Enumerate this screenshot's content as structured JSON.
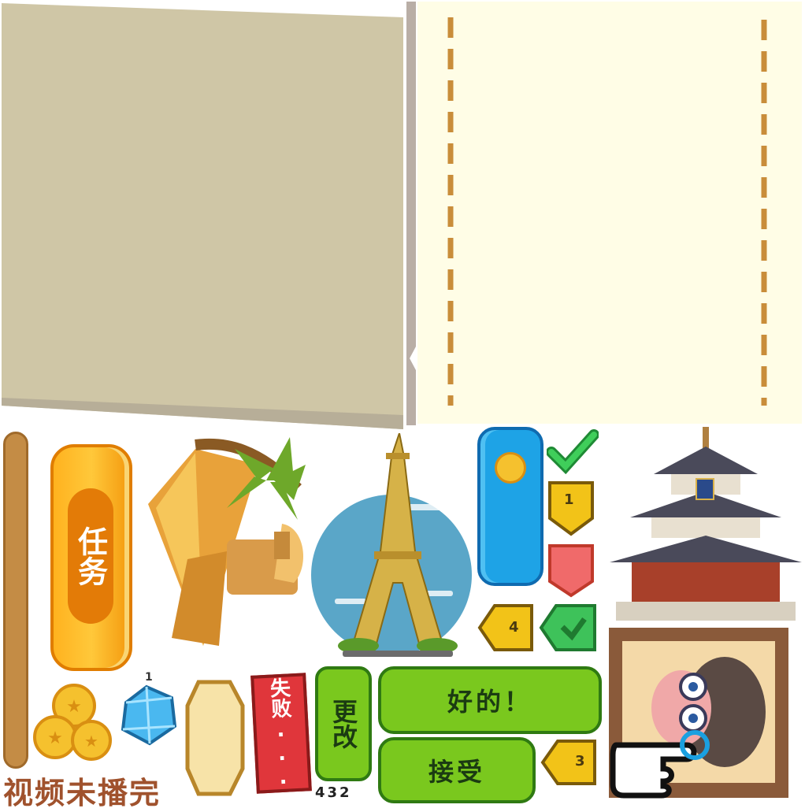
{
  "atlas": {
    "task_button_label": "任务",
    "fail_tag_label": "失败...",
    "change_button_label": "更改",
    "ok_button_label": "好的！",
    "accept_button_label": "接受",
    "video_not_finished_label": "视频未播完",
    "digits_label": "432",
    "small_one_label": "1",
    "badge_1": "1",
    "badge_4": "4",
    "badge_3": "3"
  },
  "colors": {
    "panel_gray": "#cfc6a6",
    "panel_cream": "#fffde6",
    "orange": "#f28c0f",
    "green": "#7ac81e",
    "blue": "#1aa0e0",
    "red": "#e0363b",
    "gold": "#f2c318"
  },
  "icons": [
    "coin-stack-icon",
    "diamond-icon",
    "checkmark-icon",
    "pointing-hand-icon",
    "coin-icon"
  ]
}
